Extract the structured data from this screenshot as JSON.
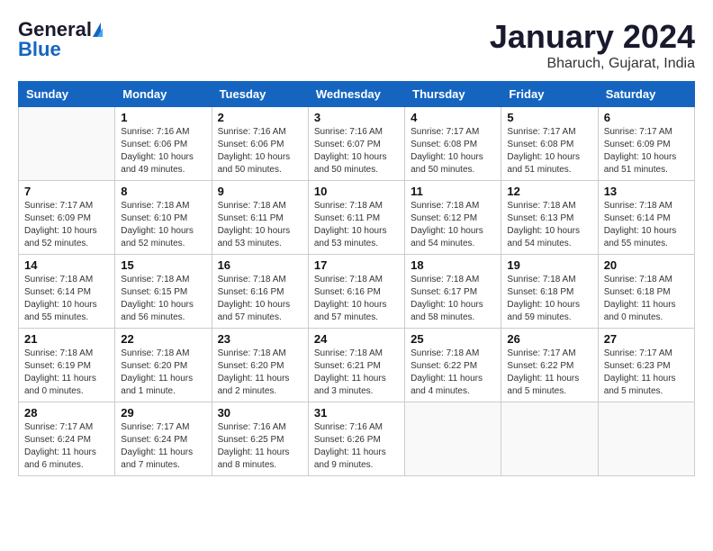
{
  "header": {
    "logo_general": "General",
    "logo_blue": "Blue",
    "month_title": "January 2024",
    "location": "Bharuch, Gujarat, India"
  },
  "calendar": {
    "days_of_week": [
      "Sunday",
      "Monday",
      "Tuesday",
      "Wednesday",
      "Thursday",
      "Friday",
      "Saturday"
    ],
    "weeks": [
      [
        {
          "day": "",
          "info": ""
        },
        {
          "day": "1",
          "info": "Sunrise: 7:16 AM\nSunset: 6:06 PM\nDaylight: 10 hours\nand 49 minutes."
        },
        {
          "day": "2",
          "info": "Sunrise: 7:16 AM\nSunset: 6:06 PM\nDaylight: 10 hours\nand 50 minutes."
        },
        {
          "day": "3",
          "info": "Sunrise: 7:16 AM\nSunset: 6:07 PM\nDaylight: 10 hours\nand 50 minutes."
        },
        {
          "day": "4",
          "info": "Sunrise: 7:17 AM\nSunset: 6:08 PM\nDaylight: 10 hours\nand 50 minutes."
        },
        {
          "day": "5",
          "info": "Sunrise: 7:17 AM\nSunset: 6:08 PM\nDaylight: 10 hours\nand 51 minutes."
        },
        {
          "day": "6",
          "info": "Sunrise: 7:17 AM\nSunset: 6:09 PM\nDaylight: 10 hours\nand 51 minutes."
        }
      ],
      [
        {
          "day": "7",
          "info": "Sunrise: 7:17 AM\nSunset: 6:09 PM\nDaylight: 10 hours\nand 52 minutes."
        },
        {
          "day": "8",
          "info": "Sunrise: 7:18 AM\nSunset: 6:10 PM\nDaylight: 10 hours\nand 52 minutes."
        },
        {
          "day": "9",
          "info": "Sunrise: 7:18 AM\nSunset: 6:11 PM\nDaylight: 10 hours\nand 53 minutes."
        },
        {
          "day": "10",
          "info": "Sunrise: 7:18 AM\nSunset: 6:11 PM\nDaylight: 10 hours\nand 53 minutes."
        },
        {
          "day": "11",
          "info": "Sunrise: 7:18 AM\nSunset: 6:12 PM\nDaylight: 10 hours\nand 54 minutes."
        },
        {
          "day": "12",
          "info": "Sunrise: 7:18 AM\nSunset: 6:13 PM\nDaylight: 10 hours\nand 54 minutes."
        },
        {
          "day": "13",
          "info": "Sunrise: 7:18 AM\nSunset: 6:14 PM\nDaylight: 10 hours\nand 55 minutes."
        }
      ],
      [
        {
          "day": "14",
          "info": "Sunrise: 7:18 AM\nSunset: 6:14 PM\nDaylight: 10 hours\nand 55 minutes."
        },
        {
          "day": "15",
          "info": "Sunrise: 7:18 AM\nSunset: 6:15 PM\nDaylight: 10 hours\nand 56 minutes."
        },
        {
          "day": "16",
          "info": "Sunrise: 7:18 AM\nSunset: 6:16 PM\nDaylight: 10 hours\nand 57 minutes."
        },
        {
          "day": "17",
          "info": "Sunrise: 7:18 AM\nSunset: 6:16 PM\nDaylight: 10 hours\nand 57 minutes."
        },
        {
          "day": "18",
          "info": "Sunrise: 7:18 AM\nSunset: 6:17 PM\nDaylight: 10 hours\nand 58 minutes."
        },
        {
          "day": "19",
          "info": "Sunrise: 7:18 AM\nSunset: 6:18 PM\nDaylight: 10 hours\nand 59 minutes."
        },
        {
          "day": "20",
          "info": "Sunrise: 7:18 AM\nSunset: 6:18 PM\nDaylight: 11 hours\nand 0 minutes."
        }
      ],
      [
        {
          "day": "21",
          "info": "Sunrise: 7:18 AM\nSunset: 6:19 PM\nDaylight: 11 hours\nand 0 minutes."
        },
        {
          "day": "22",
          "info": "Sunrise: 7:18 AM\nSunset: 6:20 PM\nDaylight: 11 hours\nand 1 minute."
        },
        {
          "day": "23",
          "info": "Sunrise: 7:18 AM\nSunset: 6:20 PM\nDaylight: 11 hours\nand 2 minutes."
        },
        {
          "day": "24",
          "info": "Sunrise: 7:18 AM\nSunset: 6:21 PM\nDaylight: 11 hours\nand 3 minutes."
        },
        {
          "day": "25",
          "info": "Sunrise: 7:18 AM\nSunset: 6:22 PM\nDaylight: 11 hours\nand 4 minutes."
        },
        {
          "day": "26",
          "info": "Sunrise: 7:17 AM\nSunset: 6:22 PM\nDaylight: 11 hours\nand 5 minutes."
        },
        {
          "day": "27",
          "info": "Sunrise: 7:17 AM\nSunset: 6:23 PM\nDaylight: 11 hours\nand 5 minutes."
        }
      ],
      [
        {
          "day": "28",
          "info": "Sunrise: 7:17 AM\nSunset: 6:24 PM\nDaylight: 11 hours\nand 6 minutes."
        },
        {
          "day": "29",
          "info": "Sunrise: 7:17 AM\nSunset: 6:24 PM\nDaylight: 11 hours\nand 7 minutes."
        },
        {
          "day": "30",
          "info": "Sunrise: 7:16 AM\nSunset: 6:25 PM\nDaylight: 11 hours\nand 8 minutes."
        },
        {
          "day": "31",
          "info": "Sunrise: 7:16 AM\nSunset: 6:26 PM\nDaylight: 11 hours\nand 9 minutes."
        },
        {
          "day": "",
          "info": ""
        },
        {
          "day": "",
          "info": ""
        },
        {
          "day": "",
          "info": ""
        }
      ]
    ]
  }
}
